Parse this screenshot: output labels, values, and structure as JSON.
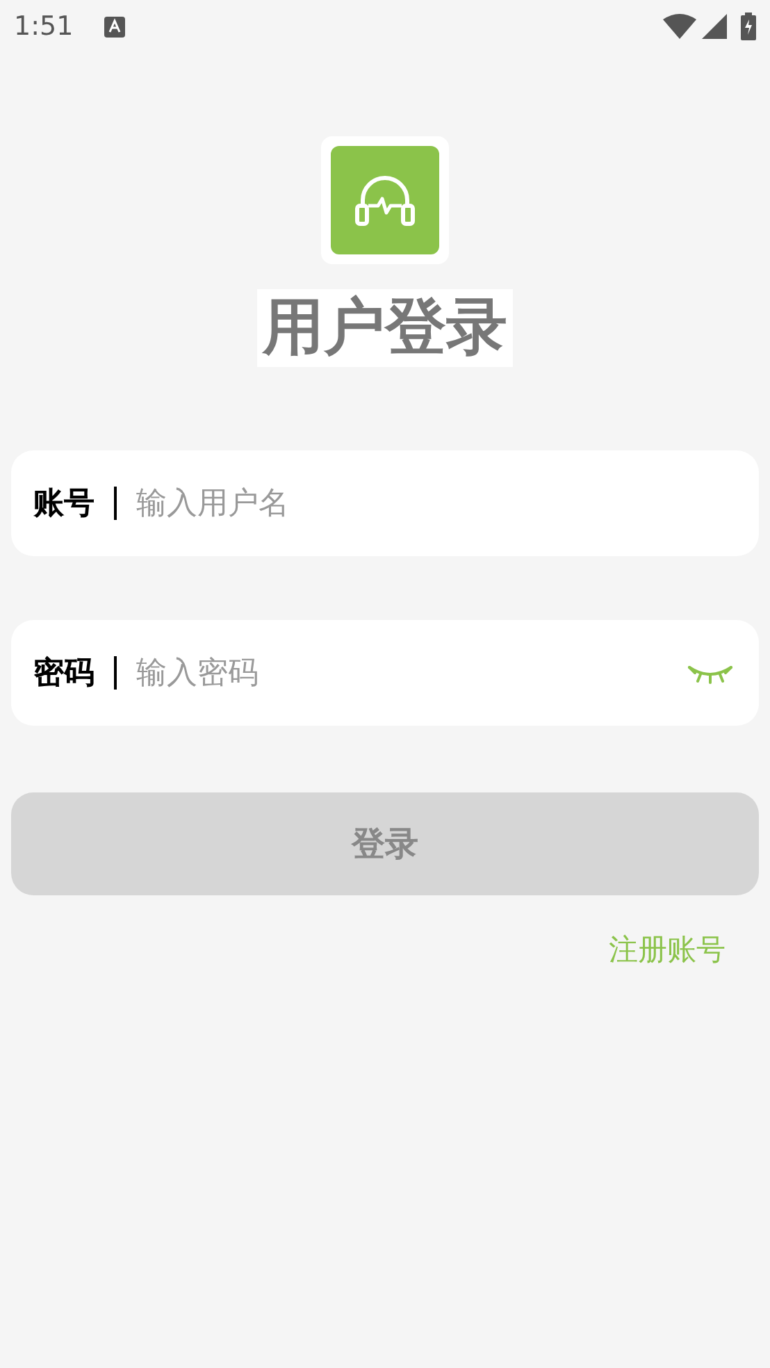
{
  "status_bar": {
    "time": "1:51"
  },
  "title": "用户登录",
  "fields": [
    {
      "label": "账号",
      "placeholder": "输入用户名",
      "kind": "text"
    },
    {
      "label": "密码",
      "placeholder": "输入密码",
      "kind": "password",
      "password_visible": false
    }
  ],
  "login_button": {
    "label": "登录",
    "disabled": true
  },
  "register_link": "注册账号"
}
